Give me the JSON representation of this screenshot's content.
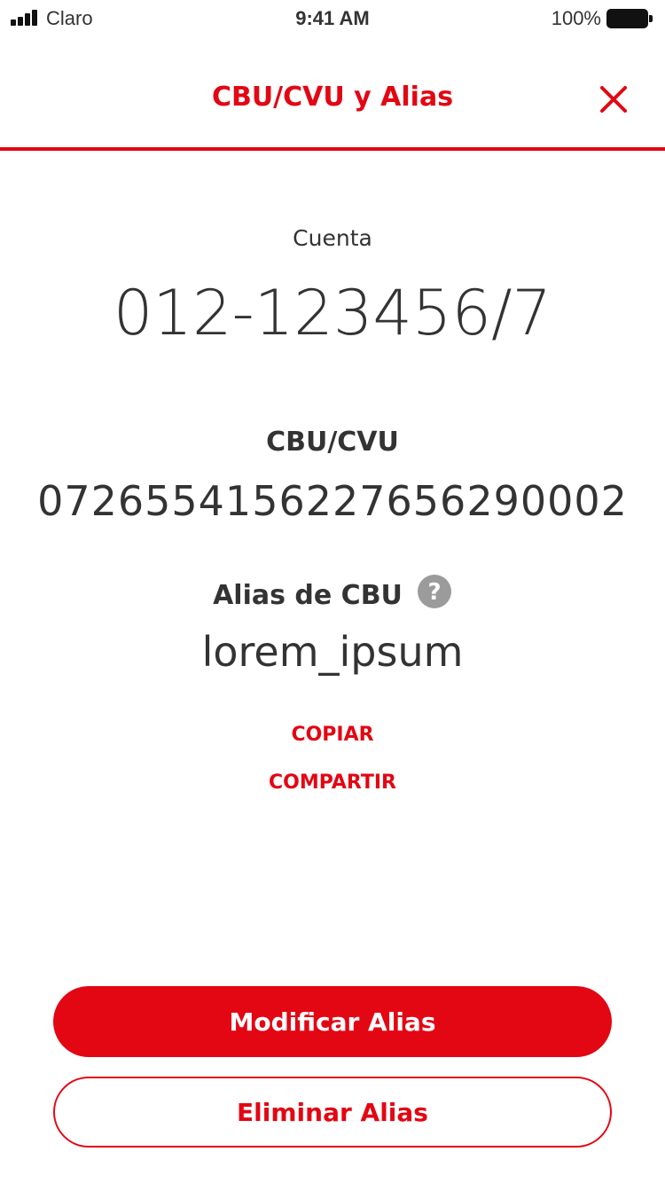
{
  "status_bar": {
    "carrier": "Claro",
    "time": "9:41 AM",
    "battery": "100%"
  },
  "header": {
    "title": "CBU/CVU y Alias",
    "close_icon": "close-icon"
  },
  "account": {
    "label": "Cuenta",
    "number": "012-123456/7"
  },
  "cbu": {
    "label": "CBU/CVU",
    "value": "0726554156227656290002"
  },
  "alias": {
    "label": "Alias de CBU",
    "help_icon": "help-icon",
    "value": "lorem_ipsum"
  },
  "actions": {
    "copy": "COPIAR",
    "share": "COMPARTIR"
  },
  "buttons": {
    "modify": "Modificar Alias",
    "delete": "Eliminar Alias"
  },
  "colors": {
    "accent": "#e30613",
    "text": "#333333",
    "help_icon": "#9b9b9b"
  }
}
